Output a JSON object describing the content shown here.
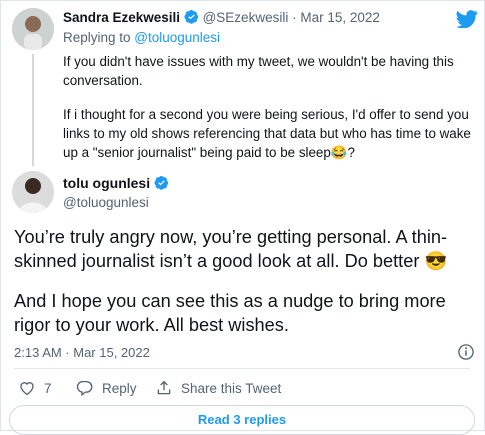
{
  "parent_tweet": {
    "author_name": "Sandra Ezekwesili",
    "handle": "@SEzekwesili",
    "separator": "·",
    "date": "Mar 15, 2022",
    "replying_prefix": "Replying to ",
    "replying_to": "@toluogunlesi",
    "paragraph1_line1": "If you didn't have issues with my tweet, we wouldn't be having this",
    "paragraph1_line2": "conversation.",
    "paragraph2_line1": "If i thought for a second you were being serious, I'd offer to send you",
    "paragraph2_line2": "links to my old shows referencing that data but who has time to wake",
    "paragraph2_line3": "up a \"senior journalist\" being paid to be sleep😂?"
  },
  "main_tweet": {
    "author_name": "tolu ogunlesi",
    "handle": "@toluogunlesi",
    "line1": "You’re truly angry now, you’re getting personal. A thin-",
    "line2": "skinned journalist isn’t a good look at all. Do better 😎",
    "line3": "And I hope you can see this as a nudge to bring more",
    "line4": "rigor to your work. All best wishes.",
    "timestamp": "2:13 AM · Mar 15, 2022"
  },
  "actions": {
    "like_count": "7",
    "reply_label": "Reply",
    "share_label": "Share this Tweet"
  },
  "read_replies_label": "Read 3 replies",
  "colors": {
    "accent": "#1d9bf0",
    "text": "#0f1419",
    "secondary": "#536471"
  },
  "icons": [
    "twitter-bird-icon",
    "verified-badge-icon",
    "info-icon",
    "heart-icon",
    "reply-icon",
    "share-icon"
  ]
}
